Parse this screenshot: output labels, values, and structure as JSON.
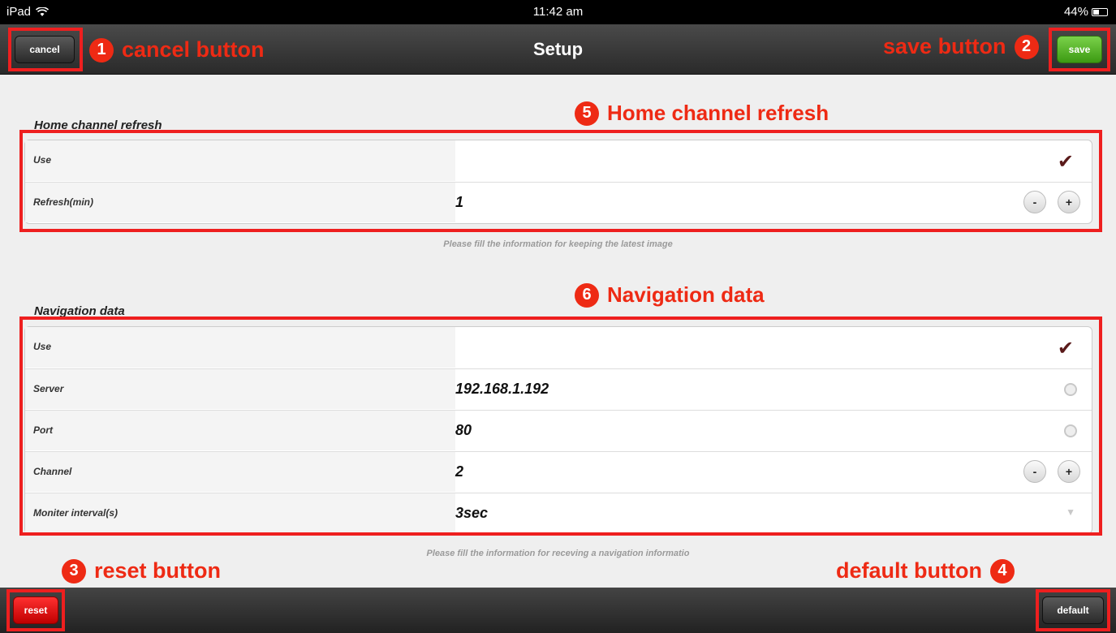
{
  "status_bar": {
    "device": "iPad",
    "time": "11:42 am",
    "battery": "44%"
  },
  "nav": {
    "title": "Setup",
    "cancel_label": "cancel",
    "save_label": "save"
  },
  "annotations": {
    "cancel": {
      "number": "1",
      "text": "cancel button"
    },
    "save": {
      "number": "2",
      "text": "save button"
    },
    "reset": {
      "number": "3",
      "text": "reset button"
    },
    "default": {
      "number": "4",
      "text": "default button"
    },
    "home": {
      "number": "5",
      "text": "Home channel refresh"
    },
    "navigation": {
      "number": "6",
      "text": "Navigation data"
    }
  },
  "home_refresh": {
    "title": "Home channel refresh",
    "use_label": "Use",
    "refresh_label": "Refresh(min)",
    "refresh_value": "1",
    "hint": "Please fill the information for keeping the latest image"
  },
  "navigation": {
    "title": "Navigation data",
    "use_label": "Use",
    "server_label": "Server",
    "server_value": "192.168.1.192",
    "port_label": "Port",
    "port_value": "80",
    "channel_label": "Channel",
    "channel_value": "2",
    "monitor_label": "Moniter interval(s)",
    "monitor_value": "3sec",
    "hint": "Please fill the information for receving a navigation informatio"
  },
  "stepper": {
    "minus": "-",
    "plus": "+"
  },
  "footer": {
    "reset_label": "reset",
    "default_label": "default"
  },
  "colors": {
    "accent_red": "#ee1f1f",
    "save_green": "#5bb82a"
  }
}
